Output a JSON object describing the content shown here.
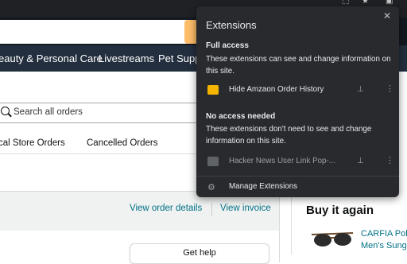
{
  "amazon": {
    "nav_items": [
      "eauty & Personal Care",
      "Livestreams",
      "Pet Suppli"
    ],
    "search_orders_placeholder": "Search all orders",
    "order_tabs": [
      "cal Store Orders",
      "Cancelled Orders"
    ],
    "order_links": [
      "View order details",
      "View invoice"
    ],
    "get_help_label": "Get help",
    "buy_again": {
      "title": "Buy it again",
      "product_line1": "CARFIA Pola",
      "product_line2": "Men's Sung"
    }
  },
  "extensions_popup": {
    "title": "Extensions",
    "close_icon": "close-icon",
    "full_access": {
      "heading": "Full access",
      "description": "These extensions can see and change information on this site.",
      "items": [
        {
          "name": "Hide Amzaon Order History",
          "icon_color": "#f4b400"
        }
      ]
    },
    "no_access": {
      "heading": "No access needed",
      "description": "These extensions don't need to see and change information on this site.",
      "items": [
        {
          "name": "Hacker News User Link Pop-...",
          "icon_color": "#9aa0a6"
        }
      ]
    },
    "manage_label": "Manage Extensions"
  },
  "colors": {
    "popup_bg": "#292a2d",
    "amazon_nav": "#232f3e",
    "amazon_link": "#007185"
  }
}
